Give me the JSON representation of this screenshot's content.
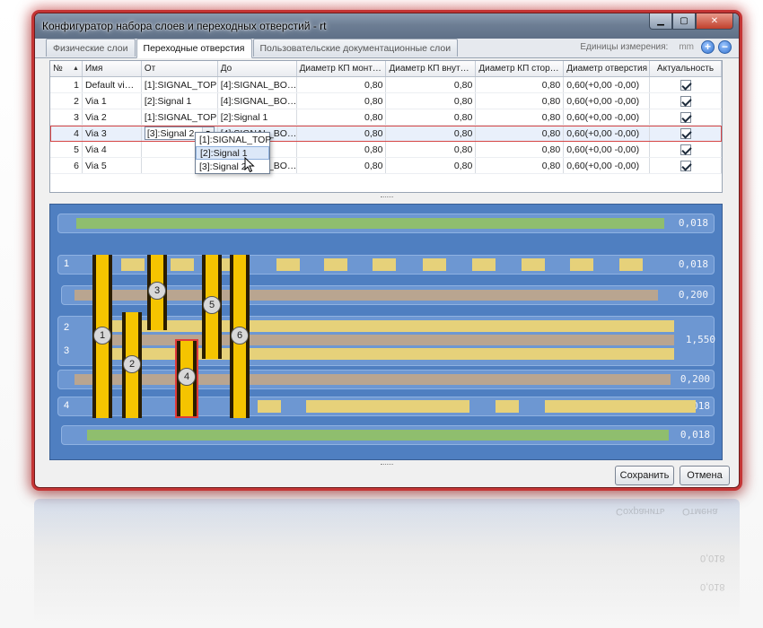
{
  "window": {
    "title": "Конфигуратор набора слоев и переходных отверстий - rt"
  },
  "tabs": [
    {
      "label": "Физические слои"
    },
    {
      "label": "Переходные отверстия"
    },
    {
      "label": "Пользовательские документационные слои"
    }
  ],
  "units": {
    "label": "Единицы измерения:",
    "value": "mm",
    "add": "+",
    "remove": "−"
  },
  "grid": {
    "headers": {
      "num": "№",
      "name": "Имя",
      "from": "От",
      "to": "До",
      "d1": "Диаметр КП монт…",
      "d2": "Диаметр КП внут…",
      "d3": "Диаметр КП стор…",
      "hole": "Диаметр отверстия",
      "actual": "Актуальность"
    },
    "rows": [
      {
        "num": "1",
        "name": "Default vi…",
        "from": "[1]:SIGNAL_TOP",
        "to": "[4]:SIGNAL_BO…",
        "d1": "0,80",
        "d2": "0,80",
        "d3": "0,80",
        "hole": "0,60(+0,00 -0,00)"
      },
      {
        "num": "2",
        "name": "Via 1",
        "from": "[2]:Signal 1",
        "to": "[4]:SIGNAL_BO…",
        "d1": "0,80",
        "d2": "0,80",
        "d3": "0,80",
        "hole": "0,60(+0,00 -0,00)"
      },
      {
        "num": "3",
        "name": "Via 2",
        "from": "[1]:SIGNAL_TOP",
        "to": "[2]:Signal 1",
        "d1": "0,80",
        "d2": "0,80",
        "d3": "0,80",
        "hole": "0,60(+0,00 -0,00)"
      },
      {
        "num": "4",
        "name": "Via 3",
        "from": "[3]:Signal 2",
        "to": "[4]:SIGNAL_BO…",
        "d1": "0,80",
        "d2": "0,80",
        "d3": "0,80",
        "hole": "0,60(+0,00 -0,00)"
      },
      {
        "num": "5",
        "name": "Via 4",
        "from": "",
        "to": "[3]:Signal 2",
        "d1": "0,80",
        "d2": "0,80",
        "d3": "0,80",
        "hole": "0,60(+0,00 -0,00)"
      },
      {
        "num": "6",
        "name": "Via 5",
        "from": "",
        "to": "[4]:SIGNAL_BO…",
        "d1": "0,80",
        "d2": "0,80",
        "d3": "0,80",
        "hole": "0,60(+0,00 -0,00)"
      }
    ],
    "dropdown": [
      "[1]:SIGNAL_TOP",
      "[2]:Signal 1",
      "[3]:Signal 2"
    ]
  },
  "stack": {
    "thickness": [
      "0,018",
      "0,018",
      "0,200",
      "1,550",
      "0,200",
      "0,018",
      "0,018"
    ],
    "layer_numbers": [
      "1",
      "2",
      "3",
      "4"
    ],
    "vias": [
      "1",
      "2",
      "3",
      "4",
      "5",
      "6"
    ]
  },
  "buttons": {
    "save": "Сохранить",
    "cancel": "Отмена"
  },
  "colors": {
    "accent_red": "#c43535",
    "stack_bg": "#4f7fc1",
    "via_yellow": "#f5c400"
  }
}
